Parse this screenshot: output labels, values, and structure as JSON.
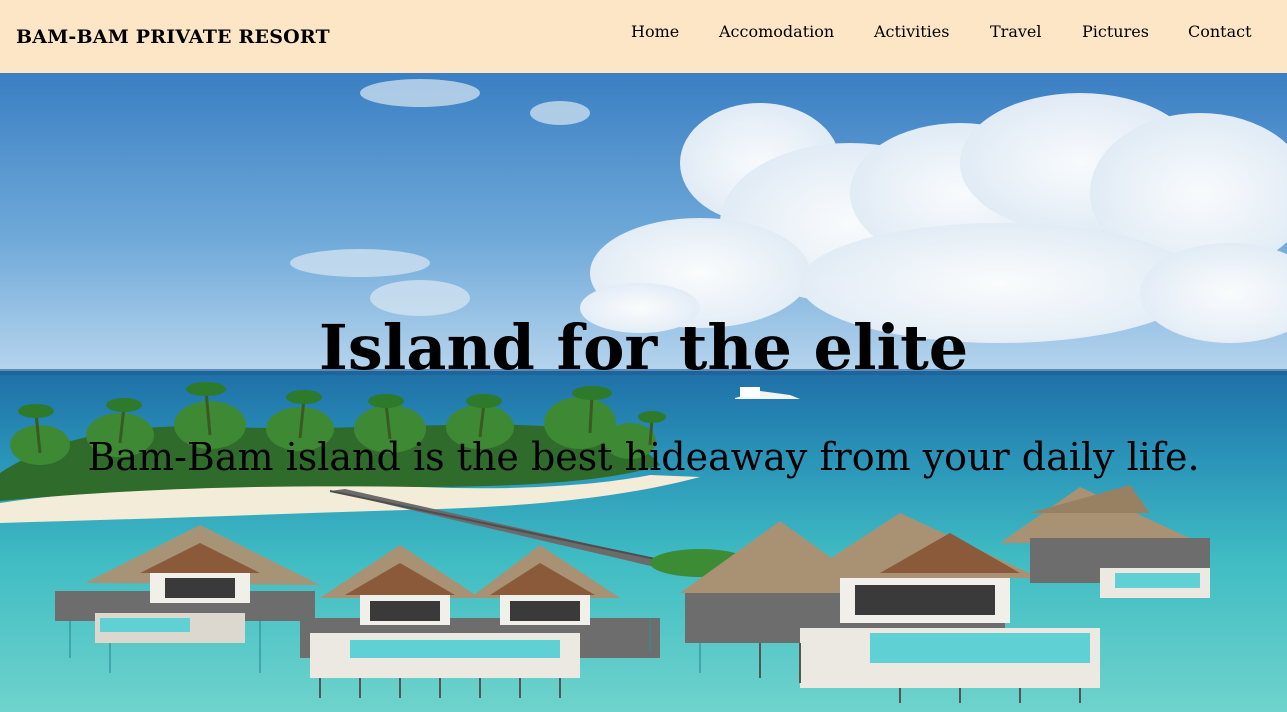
{
  "header": {
    "brand": "BAM-BAM PRIVATE RESORT",
    "nav": [
      {
        "label": "Home"
      },
      {
        "label": "Accomodation"
      },
      {
        "label": "Activities"
      },
      {
        "label": "Travel"
      },
      {
        "label": "Pictures"
      },
      {
        "label": "Contact"
      }
    ]
  },
  "hero": {
    "title": "Island for the elite",
    "subtitle": "Bam-Bam island is the best hideaway from your daily life."
  },
  "colors": {
    "header_bg": "#fde6c5",
    "text": "#000000",
    "sky_top": "#3b86c9",
    "sea": "#4fc3c7"
  }
}
